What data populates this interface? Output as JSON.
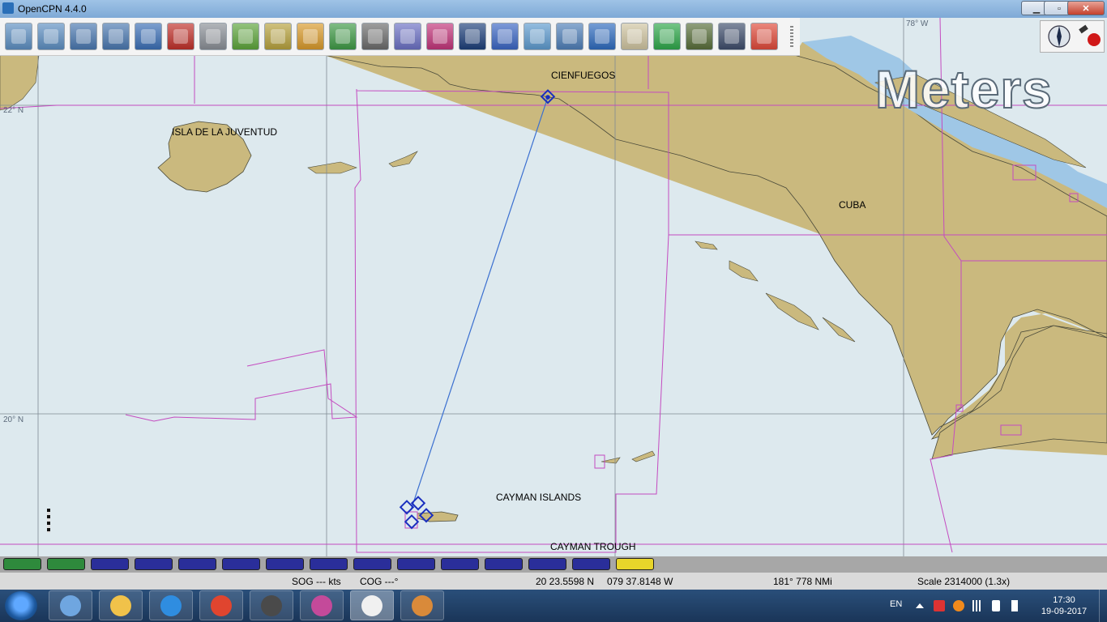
{
  "window": {
    "title": "OpenCPN 4.4.0",
    "minimize_label": "▁",
    "maximize_label": "▫",
    "close_label": "✕"
  },
  "toolbar": {
    "tools": [
      {
        "name": "zoom-in",
        "icon": "zoom-in-icon",
        "color": "#5d8fc2"
      },
      {
        "name": "zoom-out",
        "icon": "zoom-out-icon",
        "color": "#5d8fc2"
      },
      {
        "name": "scale-in",
        "icon": "scale-in-icon",
        "color": "#4a78b0"
      },
      {
        "name": "scale-out",
        "icon": "scale-out-icon",
        "color": "#4a78b0"
      },
      {
        "name": "create-route",
        "icon": "route-icon",
        "color": "#3b6fb6"
      },
      {
        "name": "auto-follow",
        "icon": "ship-icon",
        "color": "#c0302a"
      },
      {
        "name": "options",
        "icon": "wrench-icon",
        "color": "#8a8f96"
      },
      {
        "name": "text-overlay",
        "icon": "text-a-icon",
        "color": "#5da53b"
      },
      {
        "name": "current-tide",
        "icon": "tide-icon",
        "color": "#b7a23d"
      },
      {
        "name": "tide-arrows",
        "icon": "horizontal-arrows-icon",
        "color": "#d99a2b"
      },
      {
        "name": "current-arrows",
        "icon": "vertical-arrows-icon",
        "color": "#3f9a46"
      },
      {
        "name": "print",
        "icon": "printer-icon",
        "color": "#6b6b6b"
      },
      {
        "name": "route-manager",
        "icon": "route-manager-icon",
        "color": "#6b70c4"
      },
      {
        "name": "track",
        "icon": "track-icon",
        "color": "#c2357a"
      },
      {
        "name": "color-scheme",
        "icon": "color-scheme-icon",
        "color": "#1d3f7a"
      },
      {
        "name": "help",
        "icon": "help-icon",
        "color": "#3b66c4"
      },
      {
        "name": "layers",
        "icon": "layers-icon",
        "color": "#5e9bcf"
      },
      {
        "name": "gebco",
        "icon": "gebco-icon",
        "color": "#4f7fb8"
      },
      {
        "name": "google-earth",
        "icon": "globe-icon",
        "color": "#2f6bbf"
      },
      {
        "name": "logbook",
        "icon": "logbook-icon",
        "color": "#cfc4a0"
      },
      {
        "name": "lighthouse",
        "icon": "lighthouse-icon",
        "color": "#2ea84a"
      },
      {
        "name": "download",
        "icon": "download-icon",
        "color": "#586e3a"
      },
      {
        "name": "weather",
        "icon": "weather-icon",
        "color": "#3e4d6b"
      },
      {
        "name": "mob",
        "icon": "lifebuoy-icon",
        "color": "#e04a3a"
      }
    ]
  },
  "chart": {
    "units_watermark": "Meters",
    "labels": {
      "cienfuegos": "CIENFUEGOS",
      "isla": "ISLA DE LA JUVENTUD",
      "cuba": "CUBA",
      "cayman_islands": "CAYMAN ISLANDS",
      "cayman_trough": "CAYMAN TROUGH"
    },
    "lat_lon": {
      "lon_78w": "78° W",
      "lat_22n": "22° N",
      "lat_20n": "20° N"
    },
    "colors": {
      "water": "#dde9ee",
      "land": "#cab97e",
      "shallow": "#9fc7e6",
      "route": "#3a6fd0",
      "boundary": "#c44bc0"
    }
  },
  "piano": {
    "keys": [
      "#2e8a3c",
      "#2e8a3c",
      "#2a2e9a",
      "#2a2e9a",
      "#2a2e9a",
      "#2a2e9a",
      "#2a2e9a",
      "#2a2e9a",
      "#2a2e9a",
      "#2a2e9a",
      "#2a2e9a",
      "#2a2e9a",
      "#2a2e9a",
      "#2a2e9a",
      "#e8d52a"
    ]
  },
  "status": {
    "sog": "SOG --- kts",
    "cog": "COG ---°",
    "lat": "20 23.5598 N",
    "lon": "079 37.8148 W",
    "bearing_distance": "181°  778 NMi",
    "scale": "Scale 2314000 (1.3x)"
  },
  "taskbar": {
    "apps": [
      "thunderbird-icon",
      "file-explorer-icon",
      "internet-explorer-icon",
      "chrome-icon",
      "screen-capture-icon",
      "snipping-tool-icon",
      "opencpn-icon",
      "paint-icon"
    ],
    "language": "EN",
    "time": "17:30",
    "date": "19-09-2017"
  }
}
